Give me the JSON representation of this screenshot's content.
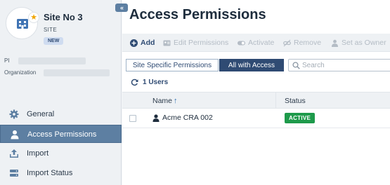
{
  "site": {
    "title": "Site No 3",
    "type": "SITE",
    "badge": "NEW",
    "pi_label": "PI",
    "org_label": "Organization"
  },
  "sidebar": {
    "collapse_label": "«",
    "items": [
      {
        "label": "General",
        "icon": "gear-icon",
        "active": false
      },
      {
        "label": "Access Permissions",
        "icon": "person-icon",
        "active": true
      },
      {
        "label": "Import",
        "icon": "upload-icon",
        "active": false
      },
      {
        "label": "Import Status",
        "icon": "server-icon",
        "active": false
      }
    ]
  },
  "main": {
    "title": "Access Permissions",
    "toolbar": {
      "add": "Add",
      "edit": "Edit Permissions",
      "activate": "Activate",
      "remove": "Remove",
      "owner": "Set as Owner"
    },
    "tabs": {
      "specific": "Site Specific Permissions",
      "all": "All with Access"
    },
    "search": {
      "placeholder": "Search",
      "value": ""
    },
    "count": "1 Users",
    "table": {
      "headers": {
        "name": "Name",
        "status": "Status"
      },
      "rows": [
        {
          "name": "Acme CRA 002",
          "status": "ACTIVE"
        }
      ]
    }
  },
  "colors": {
    "accent": "#2f4b73",
    "nav_active": "#5d7fa2",
    "status_active": "#1e9a4b",
    "star": "#f0a500"
  }
}
